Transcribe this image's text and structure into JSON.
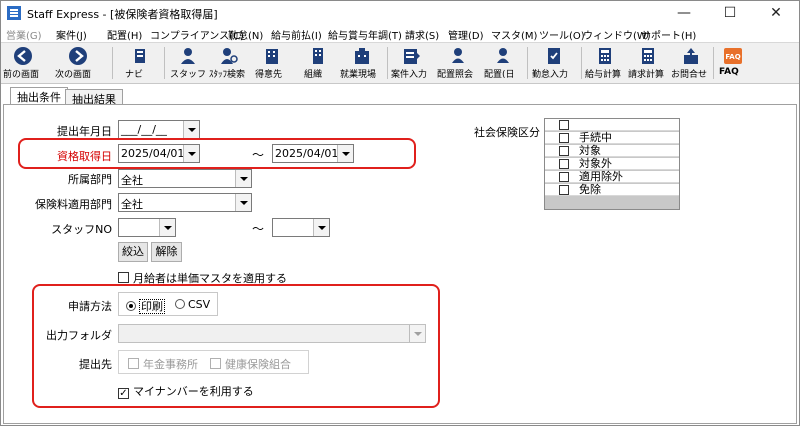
{
  "titlebar": {
    "title": "Staff Express - [被保険者資格取得届]",
    "minimize": "—",
    "maximize": "☐",
    "close": "✕"
  },
  "menu": [
    {
      "label": "営業(G)",
      "disabled": true
    },
    {
      "label": "案件(J)",
      "disabled": false
    },
    {
      "label": "配置(H)",
      "disabled": false
    },
    {
      "label": "コンプライアンス(C)",
      "disabled": false
    },
    {
      "label": "勤怠(N)",
      "disabled": false
    },
    {
      "label": "給与前払(I)",
      "disabled": false
    },
    {
      "label": "給与賞与年調(T)",
      "disabled": false
    },
    {
      "label": "請求(S)",
      "disabled": false
    },
    {
      "label": "管理(D)",
      "disabled": false
    },
    {
      "label": "マスタ(M)",
      "disabled": false
    },
    {
      "label": "ツール(O)",
      "disabled": false
    },
    {
      "label": "ウィンドウ(W)",
      "disabled": false
    },
    {
      "label": "サポート(H)",
      "disabled": false
    }
  ],
  "toolbar": {
    "prev": "前の画面",
    "next": "次の画面",
    "navi": "ナビ",
    "staff": "スタッフ",
    "staff_search": "ｽﾀｯﾌ検索",
    "client": "得意先",
    "org": "組織",
    "site": "就業現場",
    "job_entry": "案件入力",
    "assign_inquiry": "配置照会",
    "assign_day": "配置(日",
    "attendance_entry": "勤怠入力",
    "payroll_calc": "給与計算",
    "billing_calc": "請求計算",
    "inquiry": "お問合せ",
    "faq": "FAQ",
    "faq_icon_text": "FAQ"
  },
  "tabs": [
    {
      "label": "抽出条件",
      "active": true
    },
    {
      "label": "抽出結果",
      "active": false
    }
  ],
  "form": {
    "submit_ym_label": "提出年月日",
    "submit_ym_value": "___/__/__",
    "acquired_label": "資格取得日",
    "acquired_from": "2025/04/01",
    "acquired_to": "2025/04/01",
    "tilde": "～",
    "dept_label": "所属部門",
    "dept_value": "全社",
    "ins_dept_label": "保険料適用部門",
    "ins_dept_value": "全社",
    "staff_no_label": "スタッフNO",
    "staff_no_from": "",
    "staff_no_to": "",
    "filter_button": "絞込",
    "clear_button": "解除",
    "monthly_label": "月給者は単価マスタを適用する",
    "monthly_checked": false,
    "apply_method_label": "申請方法",
    "print_label": "印刷",
    "csv_label": "CSV",
    "selected_method": "print",
    "output_folder_label": "出力フォルダ",
    "output_folder_value": "",
    "submit_to_label": "提出先",
    "pension_office_label": "年金事務所",
    "health_union_label": "健康保険組合",
    "mynumber_label": "マイナンバーを利用する",
    "mynumber_checked": true
  },
  "social_insurance": {
    "label": "社会保険区分",
    "items": [
      {
        "label": "",
        "checked": false
      },
      {
        "label": "手続中",
        "checked": false
      },
      {
        "label": "対象",
        "checked": false
      },
      {
        "label": "対象外",
        "checked": false
      },
      {
        "label": "適用除外",
        "checked": false
      },
      {
        "label": "免除",
        "checked": false
      }
    ]
  },
  "colors": {
    "highlight_border": "#e0201c",
    "required_label": "#d40000",
    "toolbar_icon": "#1f3f7a",
    "faq_badge": "#e8702a"
  }
}
